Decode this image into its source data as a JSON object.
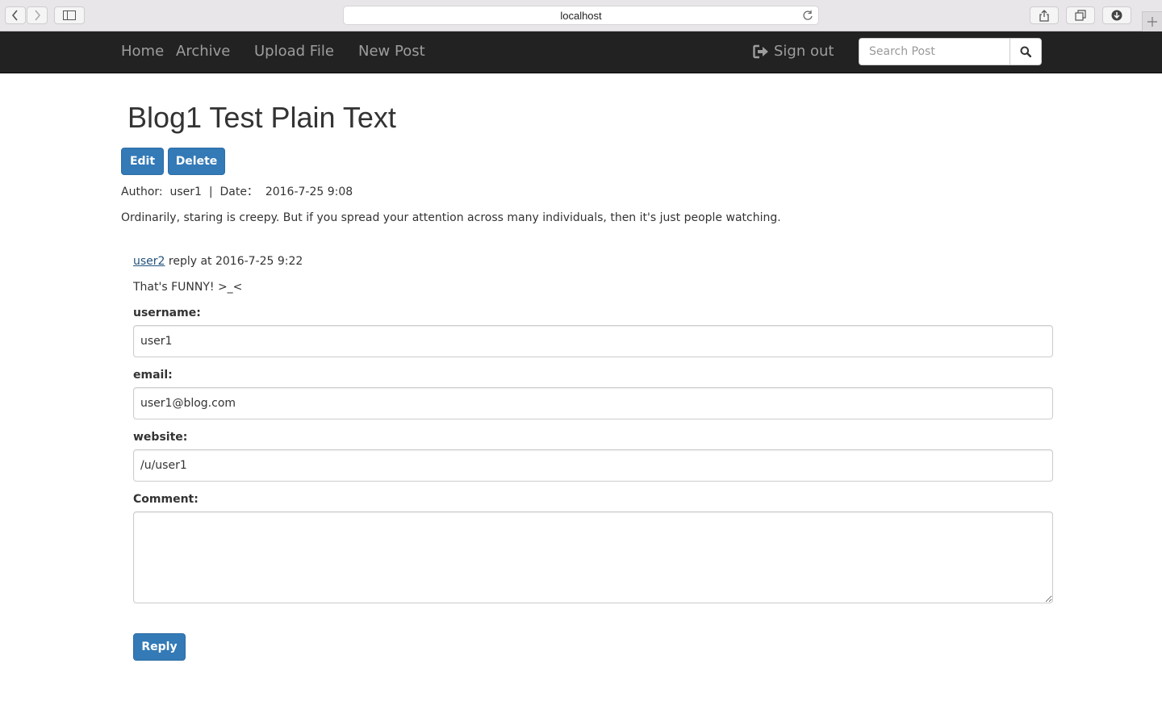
{
  "browser": {
    "address": "localhost"
  },
  "nav": {
    "home": "Home",
    "archive": "Archive",
    "upload": "Upload File",
    "new_post": "New Post",
    "sign_out": "Sign out",
    "search_placeholder": "Search Post"
  },
  "post": {
    "title": "Blog1 Test Plain Text",
    "edit_label": "Edit",
    "delete_label": "Delete",
    "meta": "Author:  user1  |  Date：  2016-7-25 9:08",
    "body": "Ordinarily, staring is creepy. But if you spread your attention across many individuals, then it's just people watching."
  },
  "reply": {
    "user": "user2",
    "info": " reply at 2016-7-25 9:22",
    "text": "That's FUNNY! >_<"
  },
  "form": {
    "username_label": "username:",
    "username_value": "user1",
    "email_label": "email:",
    "email_value": "user1@blog.com",
    "website_label": "website:",
    "website_value": "/u/user1",
    "comment_label": "Comment:",
    "comment_value": "",
    "reply_button": "Reply"
  },
  "colors": {
    "navbar": "#222222",
    "primary": "#337ab7",
    "link": "#23527c"
  }
}
